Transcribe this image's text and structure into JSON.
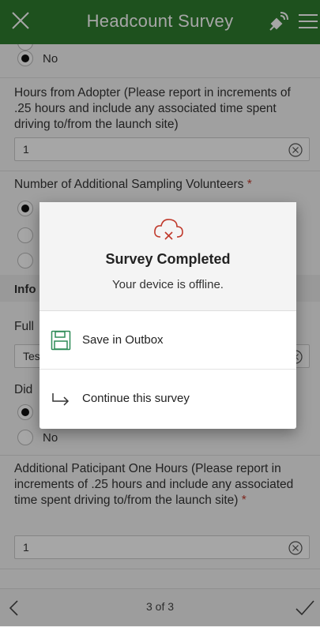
{
  "header": {
    "title": "Headcount Survey"
  },
  "form": {
    "radio_no_1": "No",
    "hours_question": "Hours from Adopter (Please report in increments of .25 hours and include any associated time spent driving to/from the launch site)",
    "hours_value": "1",
    "volunteers_question": "Number of Additional Sampling Volunteers",
    "required_mark": "*",
    "info_label": "Info",
    "full_label": "Full",
    "tes_value": "Tes",
    "did_label": "Did",
    "radio_no_2": "No",
    "additional_question": "Additional Paticipant One Hours (Please report in increments of .25 hours and include any associated time spent driving to/from the launch site)",
    "additional_value": "1"
  },
  "dialog": {
    "title": "Survey Completed",
    "message": "Your device is offline.",
    "save_label": "Save in Outbox",
    "continue_label": "Continue this survey"
  },
  "footer": {
    "page_indicator": "3 of 3"
  },
  "icons": {
    "close": "close-icon",
    "satellite": "satellite-icon",
    "menu": "menu-icon",
    "clear": "clear-circle-icon",
    "cloud_offline": "cloud-offline-icon",
    "save": "floppy-disk-icon",
    "continue": "return-arrow-icon",
    "prev": "chevron-left-icon",
    "done": "checkmark-icon"
  },
  "colors": {
    "header_bg": "#2f7d2f",
    "required": "#c0392b",
    "offline_icon": "#c0392b",
    "save_icon": "#2e8b57"
  }
}
